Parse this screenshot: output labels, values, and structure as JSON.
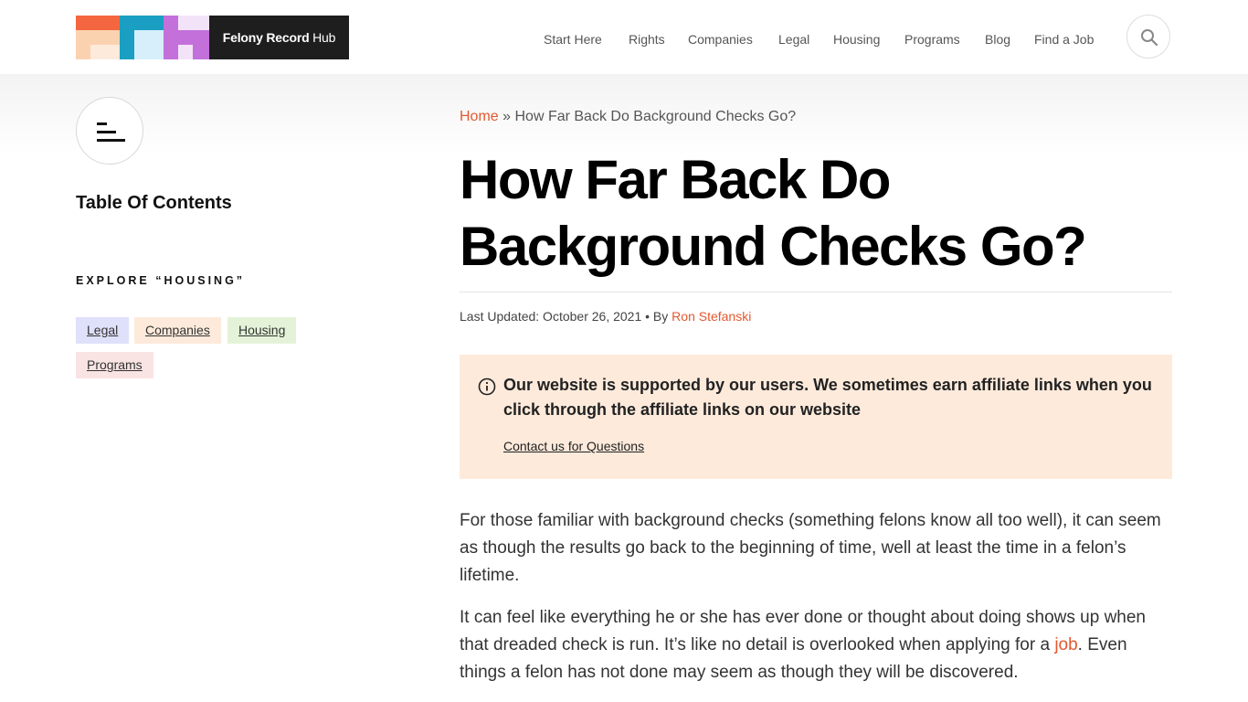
{
  "header": {
    "logo": {
      "bold": "Felony Record",
      "rest": " Hub"
    },
    "nav": [
      "Start Here",
      "Rights",
      "Companies",
      "Legal",
      "Housing",
      "Programs",
      "Blog",
      "Find a Job"
    ],
    "search_icon": "search-icon"
  },
  "sidebar": {
    "toc_icon": "menu-icon",
    "toc_title": "Table Of Contents",
    "explore_label": "EXPLORE “HOUSING”",
    "tags": [
      {
        "label": "Legal",
        "color": "#dfe1fb"
      },
      {
        "label": "Companies",
        "color": "#fdeadb"
      },
      {
        "label": "Housing",
        "color": "#e4f3d8"
      },
      {
        "label": "Programs",
        "color": "#f9e3e3"
      }
    ]
  },
  "article": {
    "breadcrumb": {
      "home": "Home",
      "sep": " » ",
      "current": "How Far Back Do Background Checks Go?"
    },
    "title": "How Far Back Do Background Checks Go?",
    "meta": {
      "updated": "Last Updated: October 26, 2021",
      "by": " • By ",
      "author": "Ron Stefanski"
    },
    "notice": {
      "icon": "info-icon",
      "message": "Our website is supported by our users. We sometimes earn affiliate links when you click through the affiliate links on our website",
      "contact": "Contact us for Questions"
    },
    "p1": "For those familiar with background checks (something felons know all too well), it can seem as though the results go back to the beginning of time, well at least the time in a felon’s lifetime.",
    "p2_start": "It can feel like everything he or she has ever done or thought about doing shows up when that dreaded check is run. It’s like no detail is overlooked when applying for a ",
    "p2_link": "job",
    "p2_end": ". Even things a felon has not done may seem as though they will be discovered."
  },
  "colors": {
    "accent": "#e4582f",
    "dark": "#1e1e1e"
  }
}
